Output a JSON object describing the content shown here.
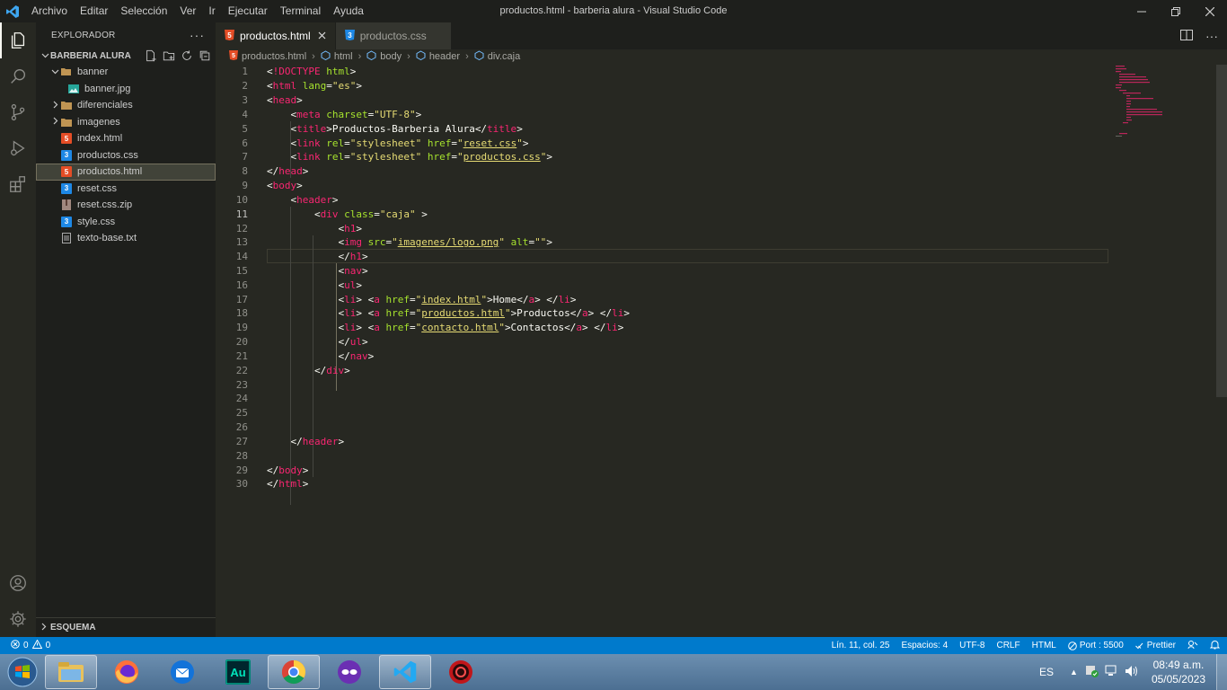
{
  "titlebar": {
    "menu": [
      "Archivo",
      "Editar",
      "Selección",
      "Ver",
      "Ir",
      "Ejecutar",
      "Terminal",
      "Ayuda"
    ],
    "window_title": "productos.html - barberia alura - Visual Studio Code"
  },
  "sidebar": {
    "header": "EXPLORADOR",
    "section": "BARBERIA ALURA",
    "items": [
      {
        "label": "banner",
        "type": "folder-open"
      },
      {
        "label": "banner.jpg",
        "type": "image"
      },
      {
        "label": "diferenciales",
        "type": "folder"
      },
      {
        "label": "imagenes",
        "type": "folder"
      },
      {
        "label": "index.html",
        "type": "html"
      },
      {
        "label": "productos.css",
        "type": "css"
      },
      {
        "label": "productos.html",
        "type": "html"
      },
      {
        "label": "reset.css",
        "type": "css"
      },
      {
        "label": "reset.css.zip",
        "type": "zip"
      },
      {
        "label": "style.css",
        "type": "css"
      },
      {
        "label": "texto-base.txt",
        "type": "txt"
      }
    ],
    "outline": "ESQUEMA"
  },
  "tabs": [
    {
      "label": "productos.html",
      "active": true
    },
    {
      "label": "productos.css",
      "active": false
    }
  ],
  "breadcrumb": [
    "productos.html",
    "html",
    "body",
    "header",
    "div.caja"
  ],
  "editor": {
    "current_line": 11,
    "line_numbers": [
      "1",
      "2",
      "3",
      "4",
      "5",
      "6",
      "7",
      "8",
      "9",
      "10",
      "11",
      "12",
      "13",
      "14",
      "15",
      "16",
      "17",
      "18",
      "19",
      "20",
      "21",
      "22",
      "23",
      "24",
      "25",
      "26",
      "27",
      "28",
      "29",
      "30"
    ]
  },
  "statusbar": {
    "errors": "0",
    "warnings": "0",
    "position": "Lín. 11, col. 25",
    "spaces": "Espacios: 4",
    "encoding": "UTF-8",
    "eol": "CRLF",
    "language": "HTML",
    "port": "Port : 5500",
    "prettier": "Prettier"
  },
  "taskbar": {
    "lang": "ES",
    "time": "08:49 a.m.",
    "date": "05/05/2023"
  },
  "colors": {
    "statusbar": "#007acc",
    "tag": "#f92672",
    "attr": "#a6e22e",
    "string": "#e6db74",
    "bg": "#272822",
    "sidebar": "#1e1f1c"
  }
}
